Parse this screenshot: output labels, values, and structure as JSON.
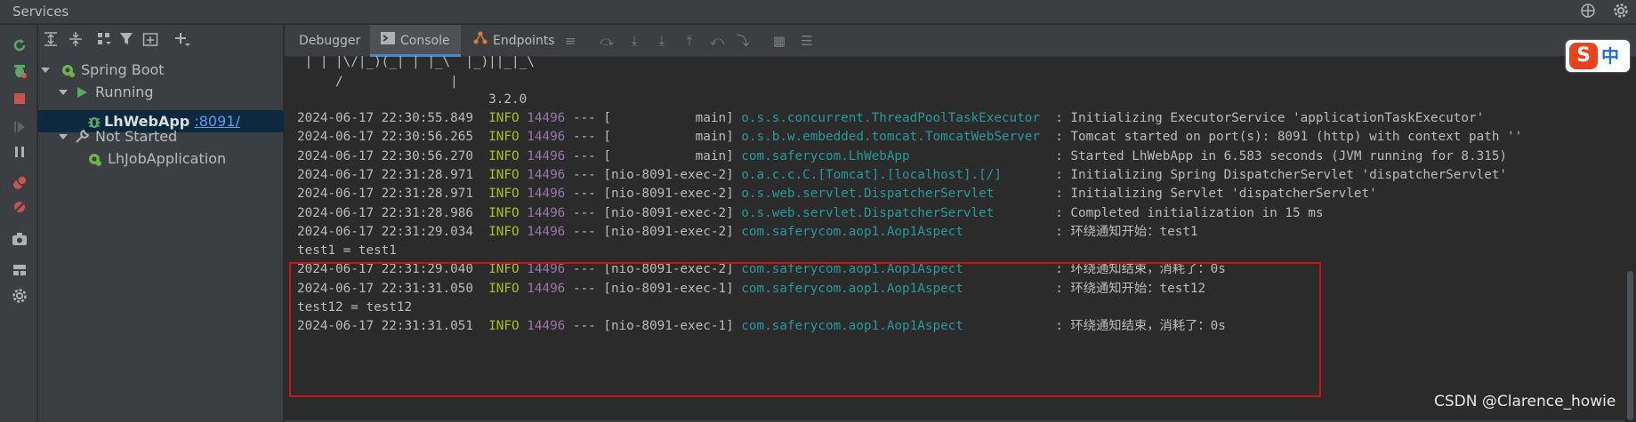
{
  "window": {
    "title": "Services",
    "icons": [
      "globe-icon",
      "gear-icon"
    ]
  },
  "left_toolbar": {
    "icons": [
      "rerun-icon",
      "debug-icon",
      "stop-icon",
      "resume-icon",
      "pause-icon",
      "breakpoints-icon",
      "mute-breakpoints-icon",
      "camera-icon",
      "layout-icon",
      "settings-icon"
    ]
  },
  "tree_toolbar": {
    "icons": [
      "expand-all-icon",
      "collapse-all-icon",
      "group-icon",
      "filter-icon",
      "new-service-icon",
      "add-icon"
    ]
  },
  "tree": {
    "items": [
      {
        "label": "Spring Boot",
        "level": 0,
        "expanded": true
      },
      {
        "label": "Running",
        "level": 1,
        "expanded": true
      },
      {
        "label": "LhWebApp",
        "port": ":8091/",
        "level": 2,
        "selected": true
      },
      {
        "label": "Not Started",
        "level": 1,
        "expanded": true
      },
      {
        "label": "LhJobApplication",
        "level": 2
      }
    ]
  },
  "tabs": [
    {
      "label": "Debugger",
      "active": false
    },
    {
      "label": "Console",
      "active": true
    },
    {
      "label": "Endpoints",
      "active": false
    }
  ],
  "console": {
    "banner": [
      " | | |\\/|_)(_| | |_\\  |_)||_|_\\",
      "     /              |",
      "                         3.2.0"
    ],
    "logs": [
      {
        "ts": "2024-06-17 22:30:55.849",
        "level": "INFO",
        "pid": "14496",
        "sep": "---",
        "thread": "[           main]",
        "logger": "o.s.s.concurrent.ThreadPoolTaskExecutor ",
        "msg": " : Initializing ExecutorService 'applicationTaskExecutor'"
      },
      {
        "ts": "2024-06-17 22:30:56.265",
        "level": "INFO",
        "pid": "14496",
        "sep": "---",
        "thread": "[           main]",
        "logger": "o.s.b.w.embedded.tomcat.TomcatWebServer ",
        "msg": " : Tomcat started on port(s): 8091 (http) with context path ''"
      },
      {
        "ts": "2024-06-17 22:30:56.270",
        "level": "INFO",
        "pid": "14496",
        "sep": "---",
        "thread": "[           main]",
        "logger": "com.saferycom.LhWebApp                  ",
        "msg": " : Started LhWebApp in 6.583 seconds (JVM running for 8.315)"
      },
      {
        "ts": "2024-06-17 22:31:28.971",
        "level": "INFO",
        "pid": "14496",
        "sep": "---",
        "thread": "[nio-8091-exec-2]",
        "logger": "o.a.c.c.C.[Tomcat].[localhost].[/]      ",
        "msg": " : Initializing Spring DispatcherServlet 'dispatcherServlet'"
      },
      {
        "ts": "2024-06-17 22:31:28.971",
        "level": "INFO",
        "pid": "14496",
        "sep": "---",
        "thread": "[nio-8091-exec-2]",
        "logger": "o.s.web.servlet.DispatcherServlet       ",
        "msg": " : Initializing Servlet 'dispatcherServlet'"
      },
      {
        "ts": "2024-06-17 22:31:28.986",
        "level": "INFO",
        "pid": "14496",
        "sep": "---",
        "thread": "[nio-8091-exec-2]",
        "logger": "o.s.web.servlet.DispatcherServlet       ",
        "msg": " : Completed initialization in 15 ms"
      },
      {
        "ts": "2024-06-17 22:31:29.034",
        "level": "INFO",
        "pid": "14496",
        "sep": "---",
        "thread": "[nio-8091-exec-2]",
        "logger": "com.saferycom.aop1.Aop1Aspect           ",
        "msg": " : 环绕通知开始：test1"
      },
      {
        "plain": "test1 = test1"
      },
      {
        "ts": "2024-06-17 22:31:29.040",
        "level": "INFO",
        "pid": "14496",
        "sep": "---",
        "thread": "[nio-8091-exec-2]",
        "logger": "com.saferycom.aop1.Aop1Aspect           ",
        "msg": " : 环绕通知结束，消耗了：0s"
      },
      {
        "ts": "2024-06-17 22:31:31.050",
        "level": "INFO",
        "pid": "14496",
        "sep": "---",
        "thread": "[nio-8091-exec-1]",
        "logger": "com.saferycom.aop1.Aop1Aspect           ",
        "msg": " : 环绕通知开始：test12"
      },
      {
        "plain": "test12 = test12"
      },
      {
        "ts": "2024-06-17 22:31:31.051",
        "level": "INFO",
        "pid": "14496",
        "sep": "---",
        "thread": "[nio-8091-exec-1]",
        "logger": "com.saferycom.aop1.Aop1Aspect           ",
        "msg": " : 环绕通知结束，消耗了：0s"
      }
    ]
  },
  "ime": {
    "brand": "S",
    "mode": "中"
  },
  "watermark": "CSDN @Clarence_howie",
  "colors": {
    "info": "#a8c023",
    "pid": "#9876aa",
    "logger": "#299999",
    "highlight": "#d40f12",
    "selection": "#0d293e"
  }
}
